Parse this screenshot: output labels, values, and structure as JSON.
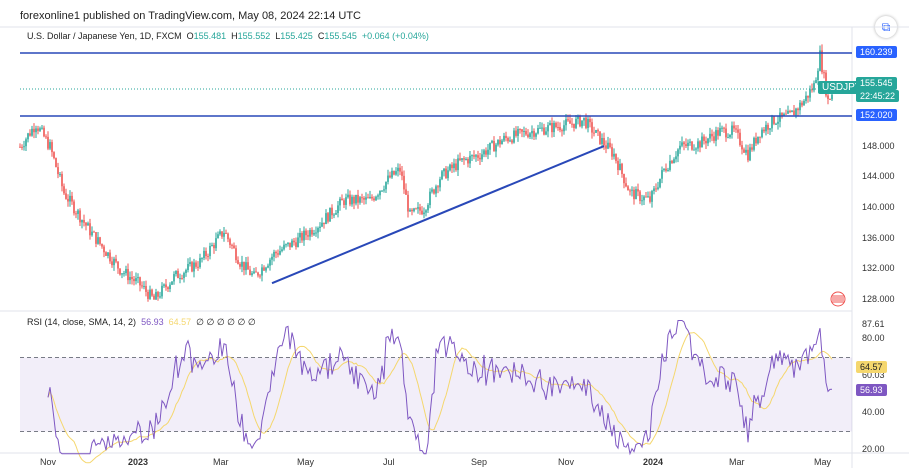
{
  "header": {
    "published": "forexonline1 published on TradingView.com, May 08, 2024 22:14 UTC"
  },
  "legend": {
    "title": "U.S. Dollar / Japanese Yen, 1D, FXCM",
    "o_label": "O",
    "o": "155.481",
    "h_label": "H",
    "h": "155.552",
    "l_label": "L",
    "l": "155.425",
    "c_label": "C",
    "c": "155.545",
    "change": "+0.064 (+0.04%)"
  },
  "rsi_legend": {
    "title": "RSI (14, close, SMA, 14, 2)",
    "rsi": "56.93",
    "sma": "64.57",
    "empty": "∅ ∅ ∅ ∅ ∅ ∅"
  },
  "price_scale": {
    "ticks": [
      "148.000",
      "144.000",
      "140.000",
      "136.000",
      "132.000",
      "128.000"
    ],
    "levels": {
      "upper": "160.239",
      "lower": "152.020"
    },
    "symbol": "USDJPY",
    "last": "155.545",
    "countdown": "22:45:22"
  },
  "rsi_scale": {
    "ticks": [
      "87.61",
      "80.00",
      "60.03",
      "40.00",
      "20.00"
    ],
    "sma": "64.57",
    "rsi": "56.93"
  },
  "time_axis": [
    "Nov",
    "2023",
    "Mar",
    "May",
    "Jul",
    "Sep",
    "Nov",
    "2024",
    "Mar",
    "May"
  ],
  "colors": {
    "up": "#26a69a",
    "down": "#ef5350",
    "line": "#2948b8",
    "rsi": "#7e57c2",
    "sma": "#f5d76e"
  },
  "chart_data": {
    "type": "candlestick",
    "symbol": "USDJPY",
    "ylim": [
      125,
      162
    ],
    "keypoints_bar_price": [
      [
        0,
        148
      ],
      [
        8,
        151
      ],
      [
        15,
        148
      ],
      [
        22,
        142
      ],
      [
        35,
        137
      ],
      [
        50,
        132
      ],
      [
        60,
        130
      ],
      [
        67,
        128
      ],
      [
        77,
        131
      ],
      [
        90,
        133
      ],
      [
        102,
        137
      ],
      [
        110,
        133
      ],
      [
        117,
        131
      ],
      [
        127,
        134
      ],
      [
        140,
        136
      ],
      [
        150,
        138
      ],
      [
        162,
        141
      ],
      [
        175,
        141
      ],
      [
        185,
        144
      ],
      [
        190,
        145
      ],
      [
        195,
        139
      ],
      [
        202,
        140
      ],
      [
        210,
        144
      ],
      [
        220,
        146
      ],
      [
        230,
        147
      ],
      [
        242,
        149
      ],
      [
        255,
        150
      ],
      [
        265,
        150.5
      ],
      [
        275,
        151
      ],
      [
        282,
        151.5
      ],
      [
        290,
        149
      ],
      [
        297,
        147
      ],
      [
        305,
        142
      ],
      [
        315,
        141
      ],
      [
        322,
        145
      ],
      [
        330,
        148
      ],
      [
        340,
        148.5
      ],
      [
        350,
        150
      ],
      [
        357,
        150
      ],
      [
        364,
        147
      ],
      [
        370,
        150
      ],
      [
        377,
        151.5
      ],
      [
        385,
        152
      ],
      [
        392,
        154
      ],
      [
        397,
        156
      ],
      [
        400,
        160
      ],
      [
        404,
        154
      ],
      [
        407,
        155.5
      ]
    ],
    "horizontal_levels": [
      160.239,
      152.02
    ],
    "trendline": [
      [
        126,
        130.2
      ],
      [
        292,
        148.1
      ]
    ],
    "rsi_bands": [
      70,
      30
    ]
  }
}
